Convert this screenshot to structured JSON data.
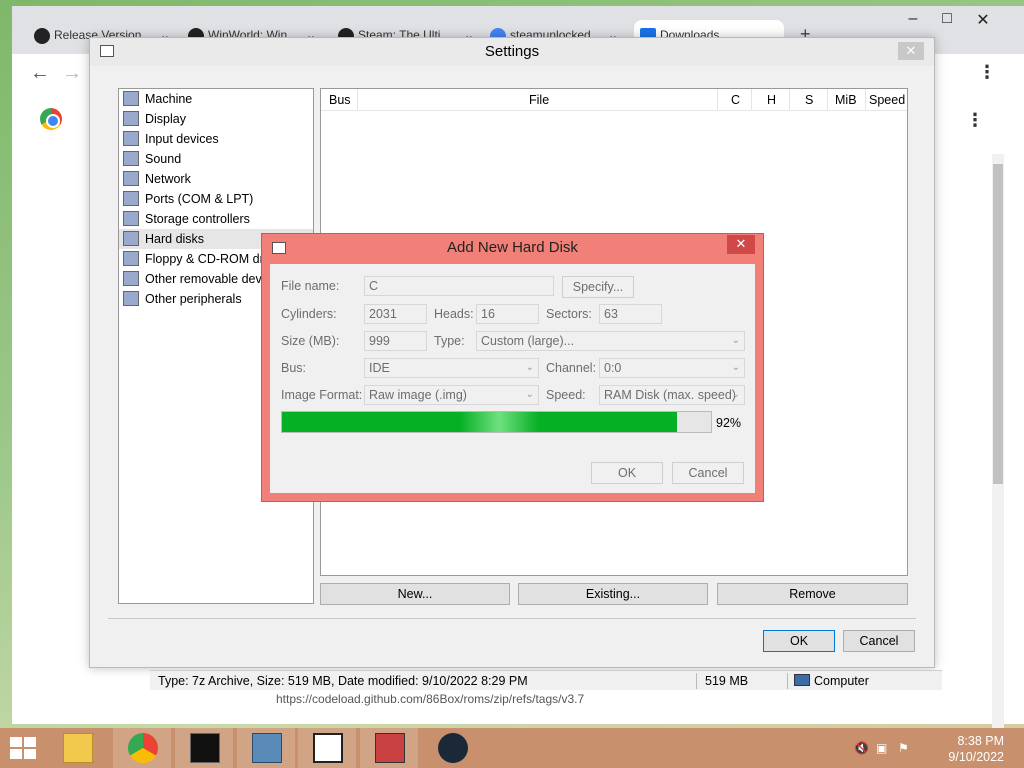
{
  "chrome": {
    "tabs": [
      {
        "label": "Release Version"
      },
      {
        "label": "WinWorld: Win"
      },
      {
        "label": "Steam: The Ulti"
      },
      {
        "label": "steamunlocked"
      },
      {
        "label": "Downloads"
      }
    ],
    "new_tab": "+",
    "back": "←",
    "forward": "→",
    "page_url_fragment": "https://codeload.github.com/86Box/roms/zip/refs/tags/v3.7"
  },
  "settings": {
    "title": "Settings",
    "close": "✕",
    "categories": [
      {
        "label": "Machine"
      },
      {
        "label": "Display"
      },
      {
        "label": "Input devices"
      },
      {
        "label": "Sound"
      },
      {
        "label": "Network"
      },
      {
        "label": "Ports (COM & LPT)"
      },
      {
        "label": "Storage controllers"
      },
      {
        "label": "Hard disks"
      },
      {
        "label": "Floppy & CD-ROM drives"
      },
      {
        "label": "Other removable devices"
      },
      {
        "label": "Other peripherals"
      }
    ],
    "selected_category": "Hard disks",
    "table_headers": {
      "bus": "Bus",
      "file": "File",
      "c": "C",
      "h": "H",
      "s": "S",
      "mib": "MiB",
      "speed": "Speed"
    },
    "new_button": "New...",
    "existing_button": "Existing...",
    "remove_button": "Remove",
    "ok_button": "OK",
    "cancel_button": "Cancel"
  },
  "statusbar": {
    "info": "Type: 7z Archive, Size: 519 MB, Date modified: 9/10/2022 8:29 PM",
    "size": "519 MB",
    "location": "Computer"
  },
  "dialog": {
    "title": "Add New Hard Disk",
    "close": "✕",
    "file_name_label": "File name:",
    "file_name_value": "C",
    "specify_button": "Specify...",
    "cylinders_label": "Cylinders:",
    "cylinders_value": "2031",
    "heads_label": "Heads:",
    "heads_value": "16",
    "sectors_label": "Sectors:",
    "sectors_value": "63",
    "size_label": "Size (MB):",
    "size_value": "999",
    "type_label": "Type:",
    "type_value": "Custom (large)...",
    "bus_label": "Bus:",
    "bus_value": "IDE",
    "channel_label": "Channel:",
    "channel_value": "0:0",
    "image_format_label": "Image Format:",
    "image_format_value": "Raw image (.img)",
    "speed_label": "Speed:",
    "speed_value": "RAM Disk (max. speed)",
    "progress_percent": 92,
    "progress_text": "92%",
    "ok_button": "OK",
    "cancel_button": "Cancel"
  },
  "taskbar": {
    "time": "8:38 PM",
    "date": "9/10/2022",
    "apps": [
      "file-explorer",
      "chrome",
      "command-prompt",
      "86box",
      "7-zip",
      "86box-manager",
      "steam"
    ],
    "accent": "#c8906c"
  }
}
